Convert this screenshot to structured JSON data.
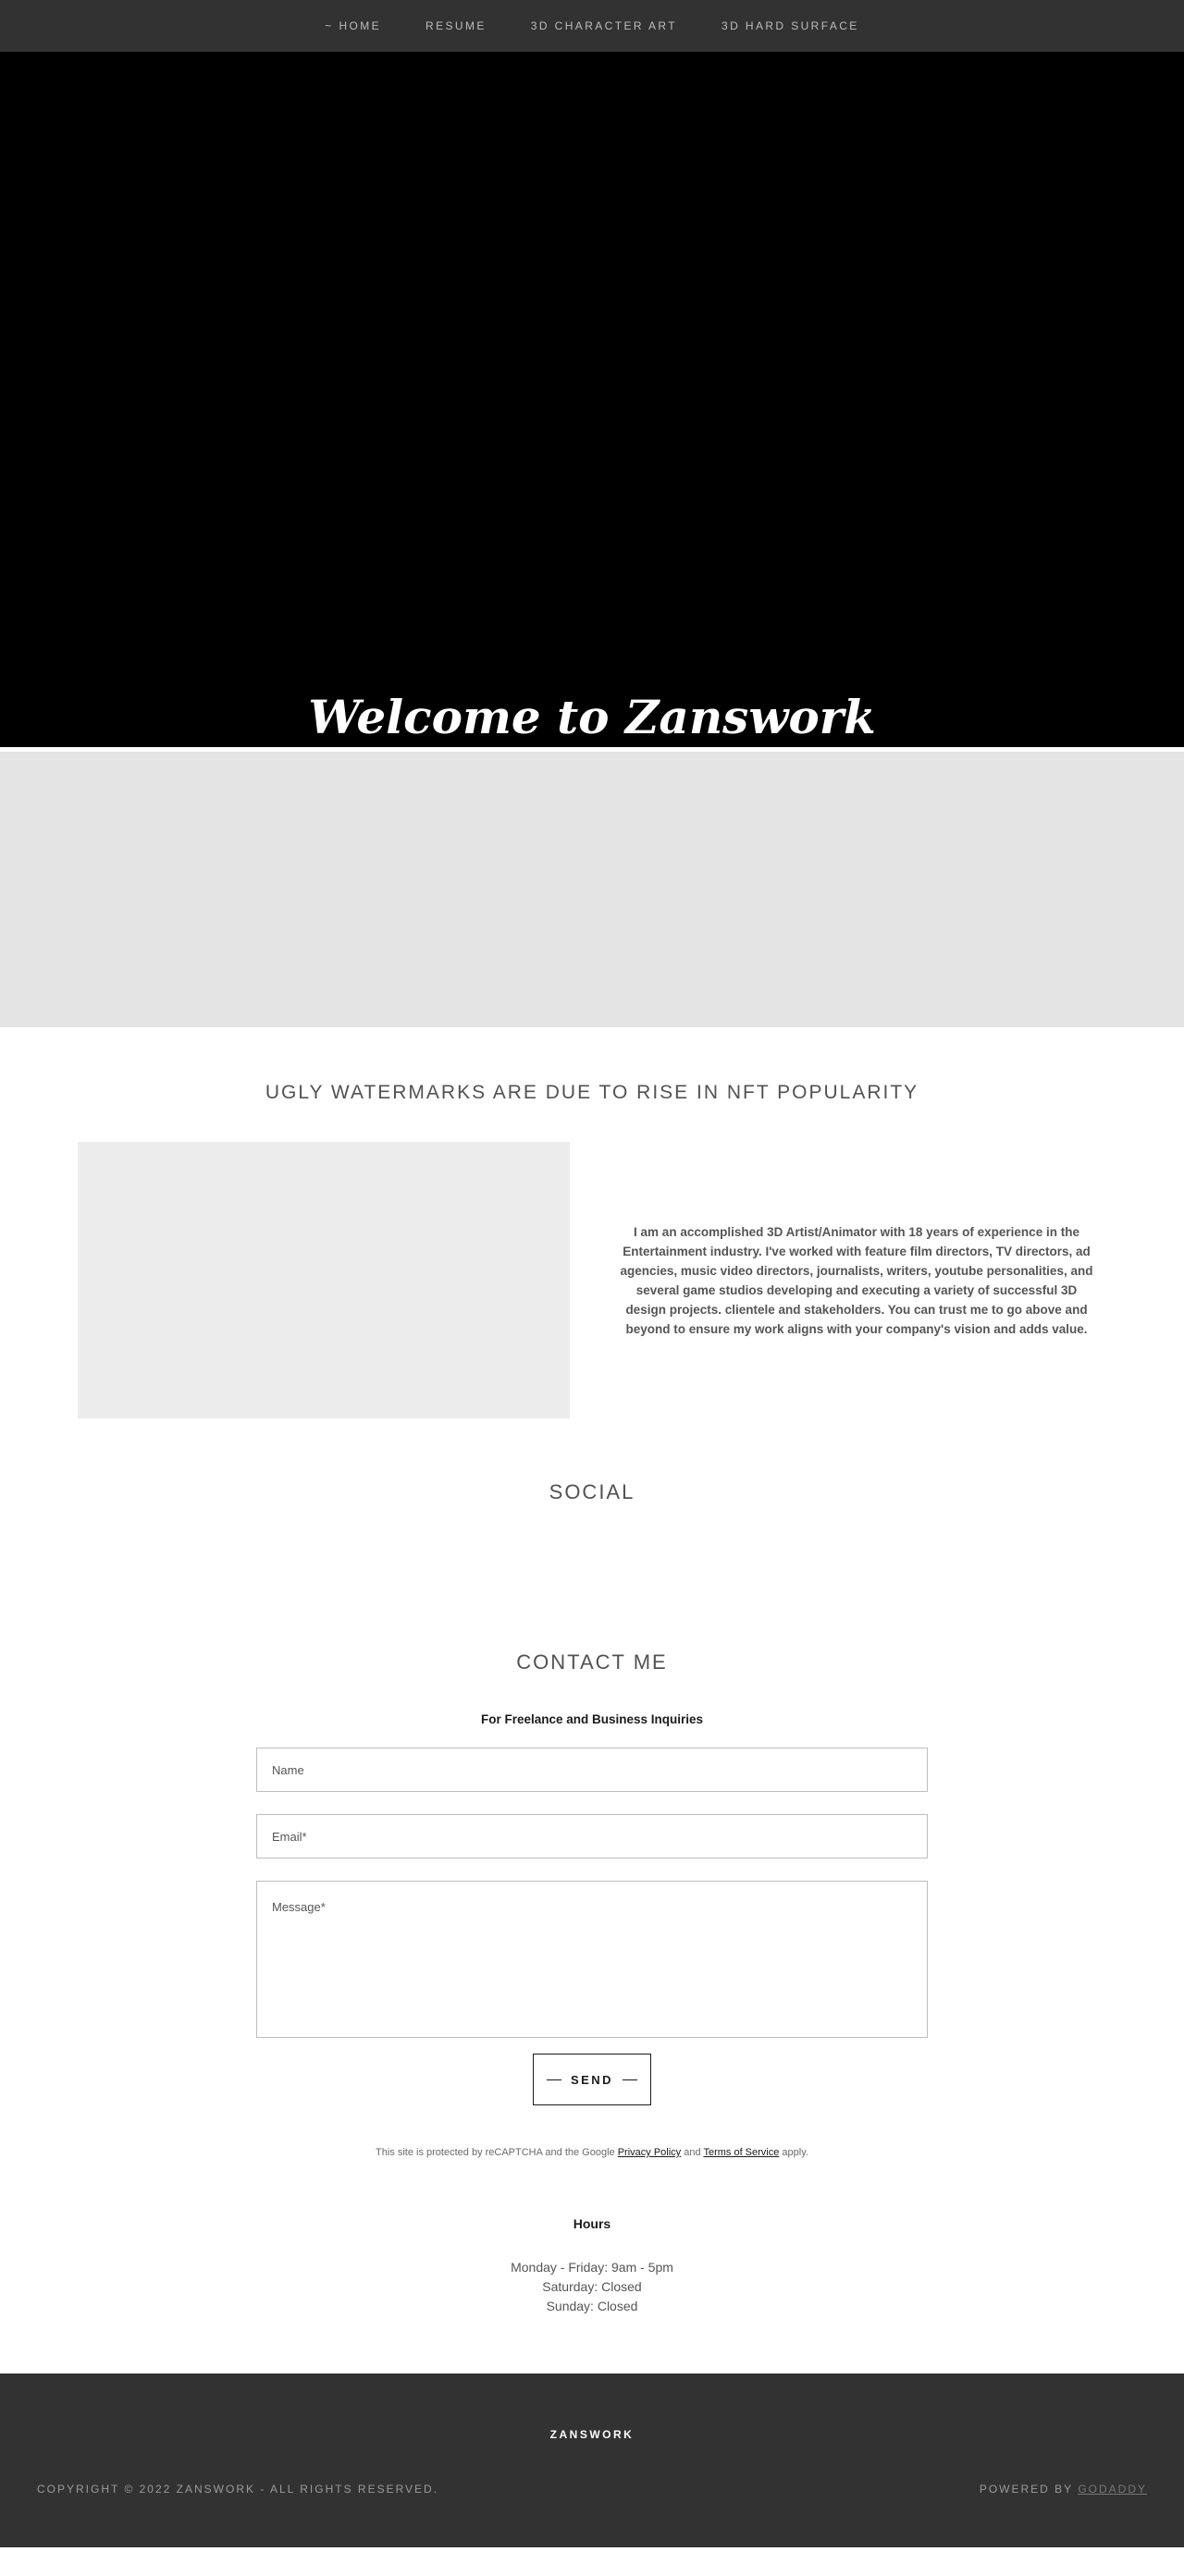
{
  "nav": {
    "items": [
      {
        "label": "~ HOME"
      },
      {
        "label": "RESUME"
      },
      {
        "label": "3D CHARACTER ART"
      },
      {
        "label": "3D HARD SURFACE"
      }
    ]
  },
  "hero": {
    "title": "Welcome to Zanswork"
  },
  "about": {
    "title": "UGLY WATERMARKS ARE DUE TO RISE IN NFT POPULARITY",
    "text": "I am an accomplished 3D Artist/Animator with 18 years of experience in the Entertainment industry. I've worked with feature film directors, TV directors, ad agencies, music video directors, journalists, writers, youtube personalities, and several game studios developing and executing a variety of successful 3D design projects. clientele and stakeholders. You can trust me to go above and beyond to ensure my work aligns with your company's vision and adds value."
  },
  "social": {
    "title": "SOCIAL"
  },
  "contact": {
    "title": "CONTACT ME",
    "subtitle": "For Freelance and Business Inquiries",
    "name_placeholder": "Name",
    "email_placeholder": "Email*",
    "message_placeholder": "Message*",
    "send_label": "SEND",
    "recaptcha_prefix": "This site is protected by reCAPTCHA and the Google ",
    "privacy_policy": "Privacy Policy",
    "and": " and ",
    "terms": "Terms of Service",
    "suffix": " apply."
  },
  "hours": {
    "title": "Hours",
    "lines": [
      "Monday - Friday: 9am - 5pm",
      "Saturday: Closed",
      "Sunday: Closed"
    ]
  },
  "footer": {
    "brand": "ZANSWORK",
    "copyright": "COPYRIGHT © 2022 ZANSWORK - ALL RIGHTS RESERVED.",
    "powered_prefix": "POWERED BY ",
    "powered_brand": "GODADDY"
  },
  "colors": {
    "nav_bg": "#323232",
    "hero_bg": "#000000",
    "gray_band": "#e4e4e4",
    "footer_bg": "#323232"
  }
}
